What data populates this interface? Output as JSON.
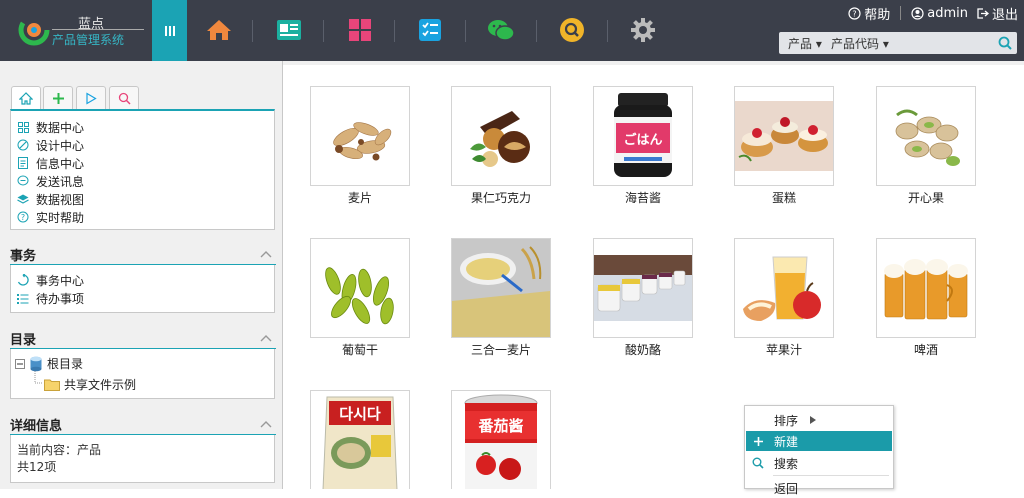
{
  "header": {
    "logo_line1": "蓝点",
    "logo_line2": "产品管理系统",
    "help": "帮助",
    "user": "admin",
    "logout": "退出",
    "search": {
      "category": "产品 ▾",
      "field": "产品代码 ▾",
      "value": ""
    },
    "nav_icons": [
      "menu-icon",
      "home-icon",
      "news-icon",
      "apps-icon",
      "tasks-icon",
      "wechat-icon",
      "search-icon",
      "settings-icon"
    ]
  },
  "sidebar": {
    "tabs": [
      "home-tab",
      "add-tab",
      "play-tab",
      "search-tab"
    ],
    "items": [
      {
        "label": "数据中心",
        "icon": "grid-icon"
      },
      {
        "label": "设计中心",
        "icon": "design-icon"
      },
      {
        "label": "信息中心",
        "icon": "document-icon"
      },
      {
        "label": "发送讯息",
        "icon": "chat-icon"
      },
      {
        "label": "数据视图",
        "icon": "layers-icon"
      },
      {
        "label": "实时帮助",
        "icon": "help-icon"
      }
    ],
    "affairs": {
      "title": "事务",
      "items": [
        {
          "label": "事务中心",
          "icon": "recycle-icon"
        },
        {
          "label": "待办事项",
          "icon": "list-icon"
        }
      ]
    },
    "catalog": {
      "title": "目录",
      "root": "根目录",
      "child": "共享文件示例"
    },
    "details": {
      "title": "详细信息",
      "current": "当前内容：产品",
      "count": "共12项"
    }
  },
  "products": [
    {
      "name": "麦片"
    },
    {
      "name": "果仁巧克力"
    },
    {
      "name": "海苔酱"
    },
    {
      "name": "蛋糕"
    },
    {
      "name": "开心果"
    },
    {
      "name": "葡萄干"
    },
    {
      "name": "三合一麦片"
    },
    {
      "name": "酸奶酪"
    },
    {
      "name": "苹果汁"
    },
    {
      "name": "啤酒"
    },
    {
      "name": "",
      "label_on_pack": "다시다"
    },
    {
      "name": "",
      "label_on_pack": "番茄酱"
    }
  ],
  "context_menu": {
    "sort": "排序",
    "new": "新建",
    "search": "搜索",
    "back": "返回"
  },
  "colors": {
    "header_bg": "#3b3f4a",
    "accent": "#1ba3b4",
    "home_icon": "#f0883e",
    "news_icon": "#1bb0a0",
    "apps_icon": "#e8457a",
    "tasks_icon": "#1aa3e0",
    "wechat_icon": "#2db84d",
    "search_icon": "#f0b429",
    "settings_icon": "#bbbbbb"
  }
}
